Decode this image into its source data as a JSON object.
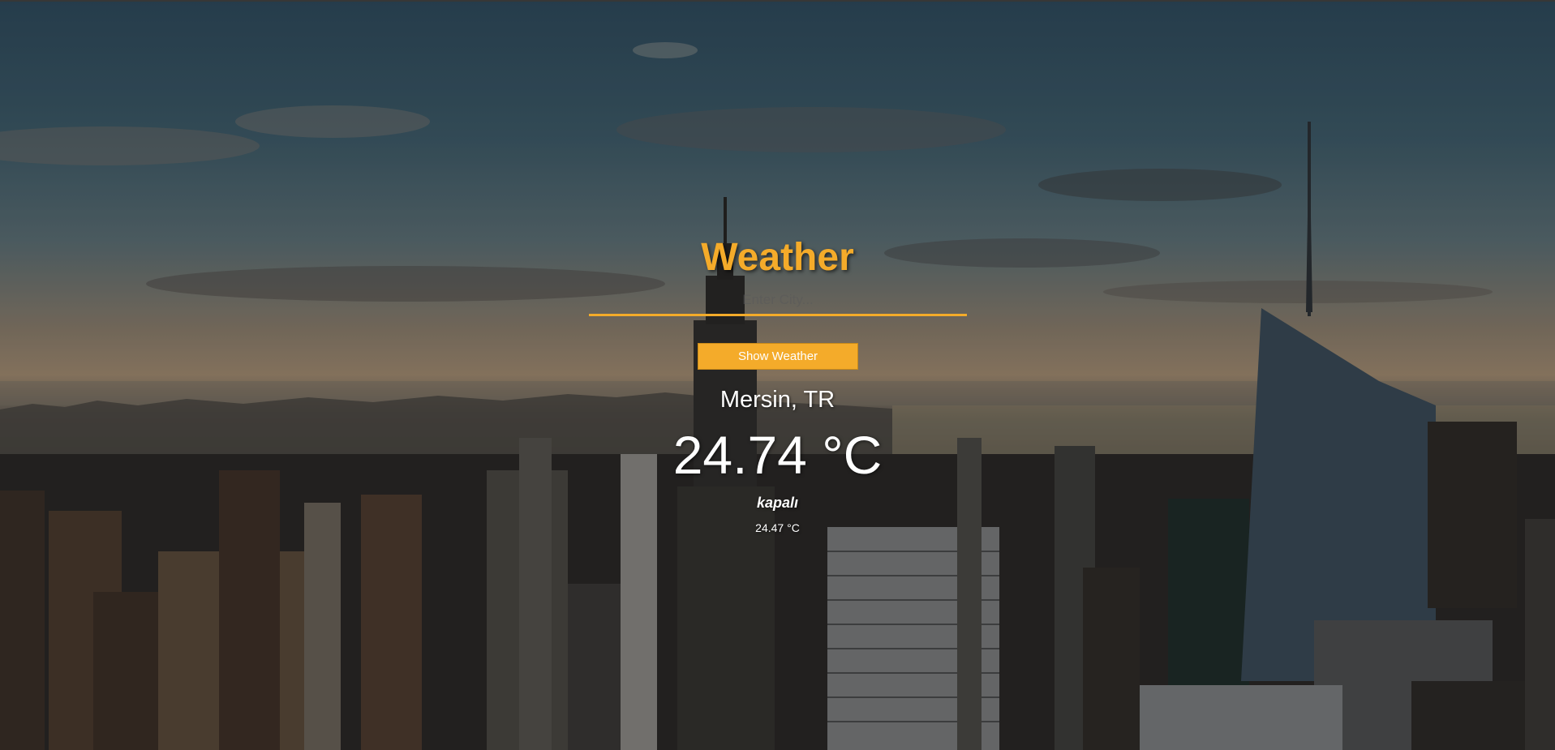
{
  "app": {
    "title": "Weather"
  },
  "search": {
    "placeholder": "Enter City...",
    "value": ""
  },
  "actions": {
    "show_weather_label": "Show Weather"
  },
  "weather": {
    "location": "Mersin, TR",
    "temperature": "24.74 °C",
    "description": "kapalı",
    "min_max": "24.47 °C"
  },
  "colors": {
    "accent": "#f4ab2a",
    "text": "#ffffff"
  }
}
